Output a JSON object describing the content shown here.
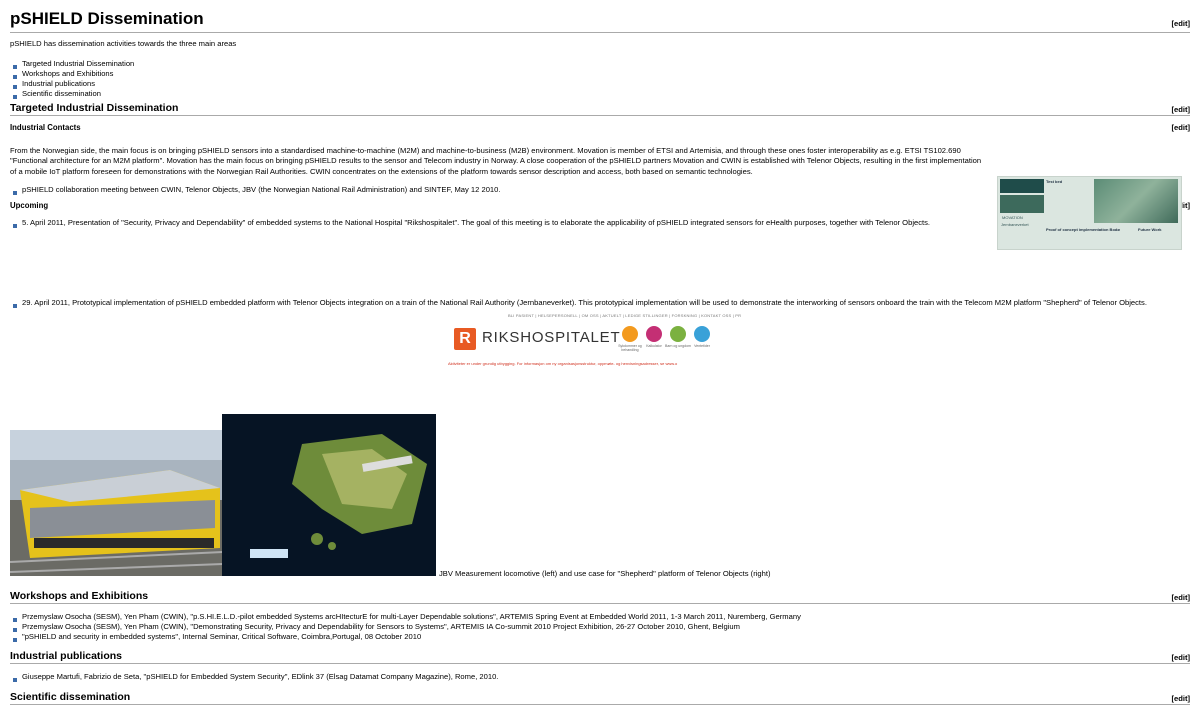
{
  "title": "pSHIELD Dissemination",
  "edit_label": "[edit]",
  "intro": "pSHIELD has dissemination activities towards the three main areas",
  "areas": [
    "Targeted Industrial Dissemination",
    "Workshops and Exhibitions",
    "Industrial publications",
    "Scientific dissemination"
  ],
  "sections": {
    "targeted": {
      "heading": "Targeted Industrial Dissemination",
      "contacts_heading": "Industrial Contacts",
      "contacts_text": "From the Norwegian side, the main focus is on bringing pSHIELD sensors into a standardised machine-to-machine (M2M) and machine-to-business (M2B) environment. Movation is member of ETSI and Artemisia, and through these ones foster interoperability as e.g. ETSI TS102.690 \"Functional architecture for an M2M platform\". Movation has the main focus on bringing pSHIELD results to the sensor and Telecom industry in Norway. A close cooperation of the pSHIELD partners Movation and CWIN is established with Telenor Objects, resulting in the first implementation of a mobile IoT platform foreseen for demonstrations with the Norwegian Rail Authorities. CWIN concentrates on the extensions of the platform towards sensor description and access, both based on semantic technologies.",
      "contacts_item": "pSHIELD collaboration meeting between CWIN, Telenor Objects, JBV (the Norwegian National Rail Administration) and SINTEF, May 12 2010.",
      "upcoming_heading": "Upcoming",
      "upcoming_item1": "5. April 2011, Presentation of \"Security, Privacy and Dependability\" of embedded systems to the National Hospital \"Rikshospitalet\". The goal of this meeting is to elaborate the applicability of pSHIELD integrated sensors for eHealth purposes, together with Telenor Objects.",
      "upcoming_item2": "29. April 2011, Prototypical implementation of pSHIELD embedded platform with Telenor Objects integration on a train of the National Rail Authority (Jernbaneverket). This prototypical implementation will be used to demonstrate the interworking of sensors onboard the train with the Telecom M2M platform \"Shepherd\" of Telenor Objects.",
      "photo_caption": "JBV Measurement locomotive (left) and use case for \"Shepherd\" platform of Telenor Objects (right)"
    },
    "workshops": {
      "heading": "Workshops and Exhibitions",
      "items": [
        "Przemyslaw Osocha (SESM), Yen Pham (CWIN), \"p.S.HI.E.L.D.-pilot embedded Systems arcHItecturE for multi-Layer Dependable solutions\", ARTEMIS Spring Event at Embedded World 2011, 1-3 March 2011, Nuremberg, Germany",
        "Przemyslaw Osocha (SESM), Yen Pham (CWIN), \"Demonstrating Security, Privacy and Dependability for Sensors to Systems\", ARTEMIS IA Co-summit 2010 Project Exhibition, 26-27 October 2010, Ghent, Belgium",
        "\"pSHIELD and security in embedded systems\", Internal Seminar, Critical Software, Coimbra,Portugal, 08 October 2010"
      ]
    },
    "publications": {
      "heading": "Industrial publications",
      "items": [
        "Giuseppe Martufi, Fabrizio de Seta, \"pSHIELD for Embedded System Security\", EDlink 37 (Elsag Datamat Company Magazine), Rome, 2010."
      ]
    },
    "scientific": {
      "heading": "Scientific dissemination"
    }
  },
  "rikshospitalet_banner": {
    "nav": "BLI PASIENT | HELSEPERSONELL | OM OSS | AKTUELT | LEDIGE STILLINGER | FORSKNING | KONTAKT OSS | PR",
    "logo_name": "RIKSHOSPITALET",
    "shortcuts": [
      "Sykdommer og behandling",
      "Kalkulator",
      "Barn og ungdom",
      "Ventetider"
    ],
    "footer": "Aktiviteter er under grundig utbygging. For informasjon om ny organisasjonsstruktur, oppmøte- og henvisningsadresser, se www.o"
  },
  "poster": {
    "lines": [
      "Eksperiment",
      "Test bed",
      "Proof of concept implementation Bodø",
      "Future Work"
    ],
    "logos": [
      "MOVATION",
      "Jernbaneverket"
    ]
  },
  "colors": {
    "bullet": "#3b6aa8",
    "rikshospitalet": "#e85a23"
  }
}
